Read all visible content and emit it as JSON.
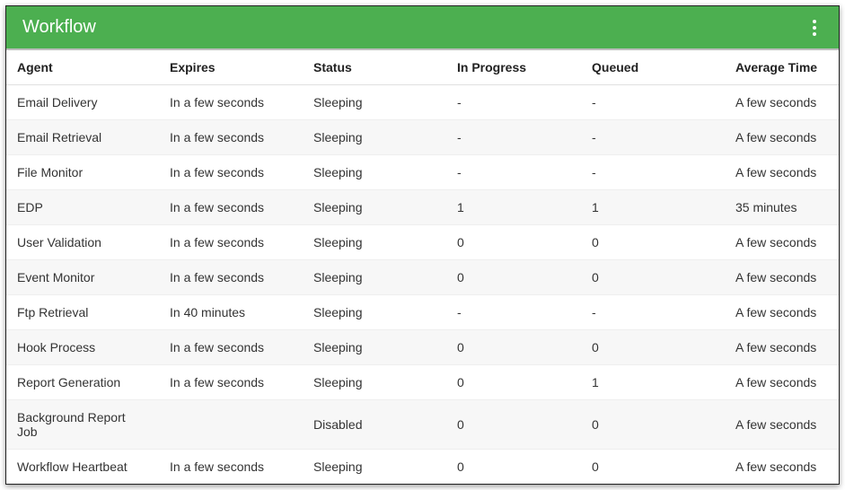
{
  "panel": {
    "title": "Workflow"
  },
  "table": {
    "columns": [
      "Agent",
      "Expires",
      "Status",
      "In Progress",
      "Queued",
      "Average Time"
    ],
    "rows": [
      {
        "agent": "Email Delivery",
        "expires": "In a few seconds",
        "status": "Sleeping",
        "in_progress": "-",
        "queued": "-",
        "average_time": "A few seconds"
      },
      {
        "agent": "Email Retrieval",
        "expires": "In a few seconds",
        "status": "Sleeping",
        "in_progress": "-",
        "queued": "-",
        "average_time": "A few seconds"
      },
      {
        "agent": "File Monitor",
        "expires": "In a few seconds",
        "status": "Sleeping",
        "in_progress": "-",
        "queued": "-",
        "average_time": "A few seconds"
      },
      {
        "agent": "EDP",
        "expires": "In a few seconds",
        "status": "Sleeping",
        "in_progress": "1",
        "queued": "1",
        "average_time": "35 minutes"
      },
      {
        "agent": "User Validation",
        "expires": "In a few seconds",
        "status": "Sleeping",
        "in_progress": "0",
        "queued": "0",
        "average_time": "A few seconds"
      },
      {
        "agent": "Event Monitor",
        "expires": "In a few seconds",
        "status": "Sleeping",
        "in_progress": "0",
        "queued": "0",
        "average_time": "A few seconds"
      },
      {
        "agent": "Ftp Retrieval",
        "expires": "In 40 minutes",
        "status": "Sleeping",
        "in_progress": "-",
        "queued": "-",
        "average_time": "A few seconds"
      },
      {
        "agent": "Hook Process",
        "expires": "In a few seconds",
        "status": "Sleeping",
        "in_progress": "0",
        "queued": "0",
        "average_time": "A few seconds"
      },
      {
        "agent": "Report Generation",
        "expires": "In a few seconds",
        "status": "Sleeping",
        "in_progress": "0",
        "queued": "1",
        "average_time": "A few seconds"
      },
      {
        "agent": "Background Report Job",
        "expires": "",
        "status": "Disabled",
        "in_progress": "0",
        "queued": "0",
        "average_time": "A few seconds"
      },
      {
        "agent": "Workflow Heartbeat",
        "expires": "In a few seconds",
        "status": "Sleeping",
        "in_progress": "0",
        "queued": "0",
        "average_time": "A few seconds"
      }
    ]
  }
}
